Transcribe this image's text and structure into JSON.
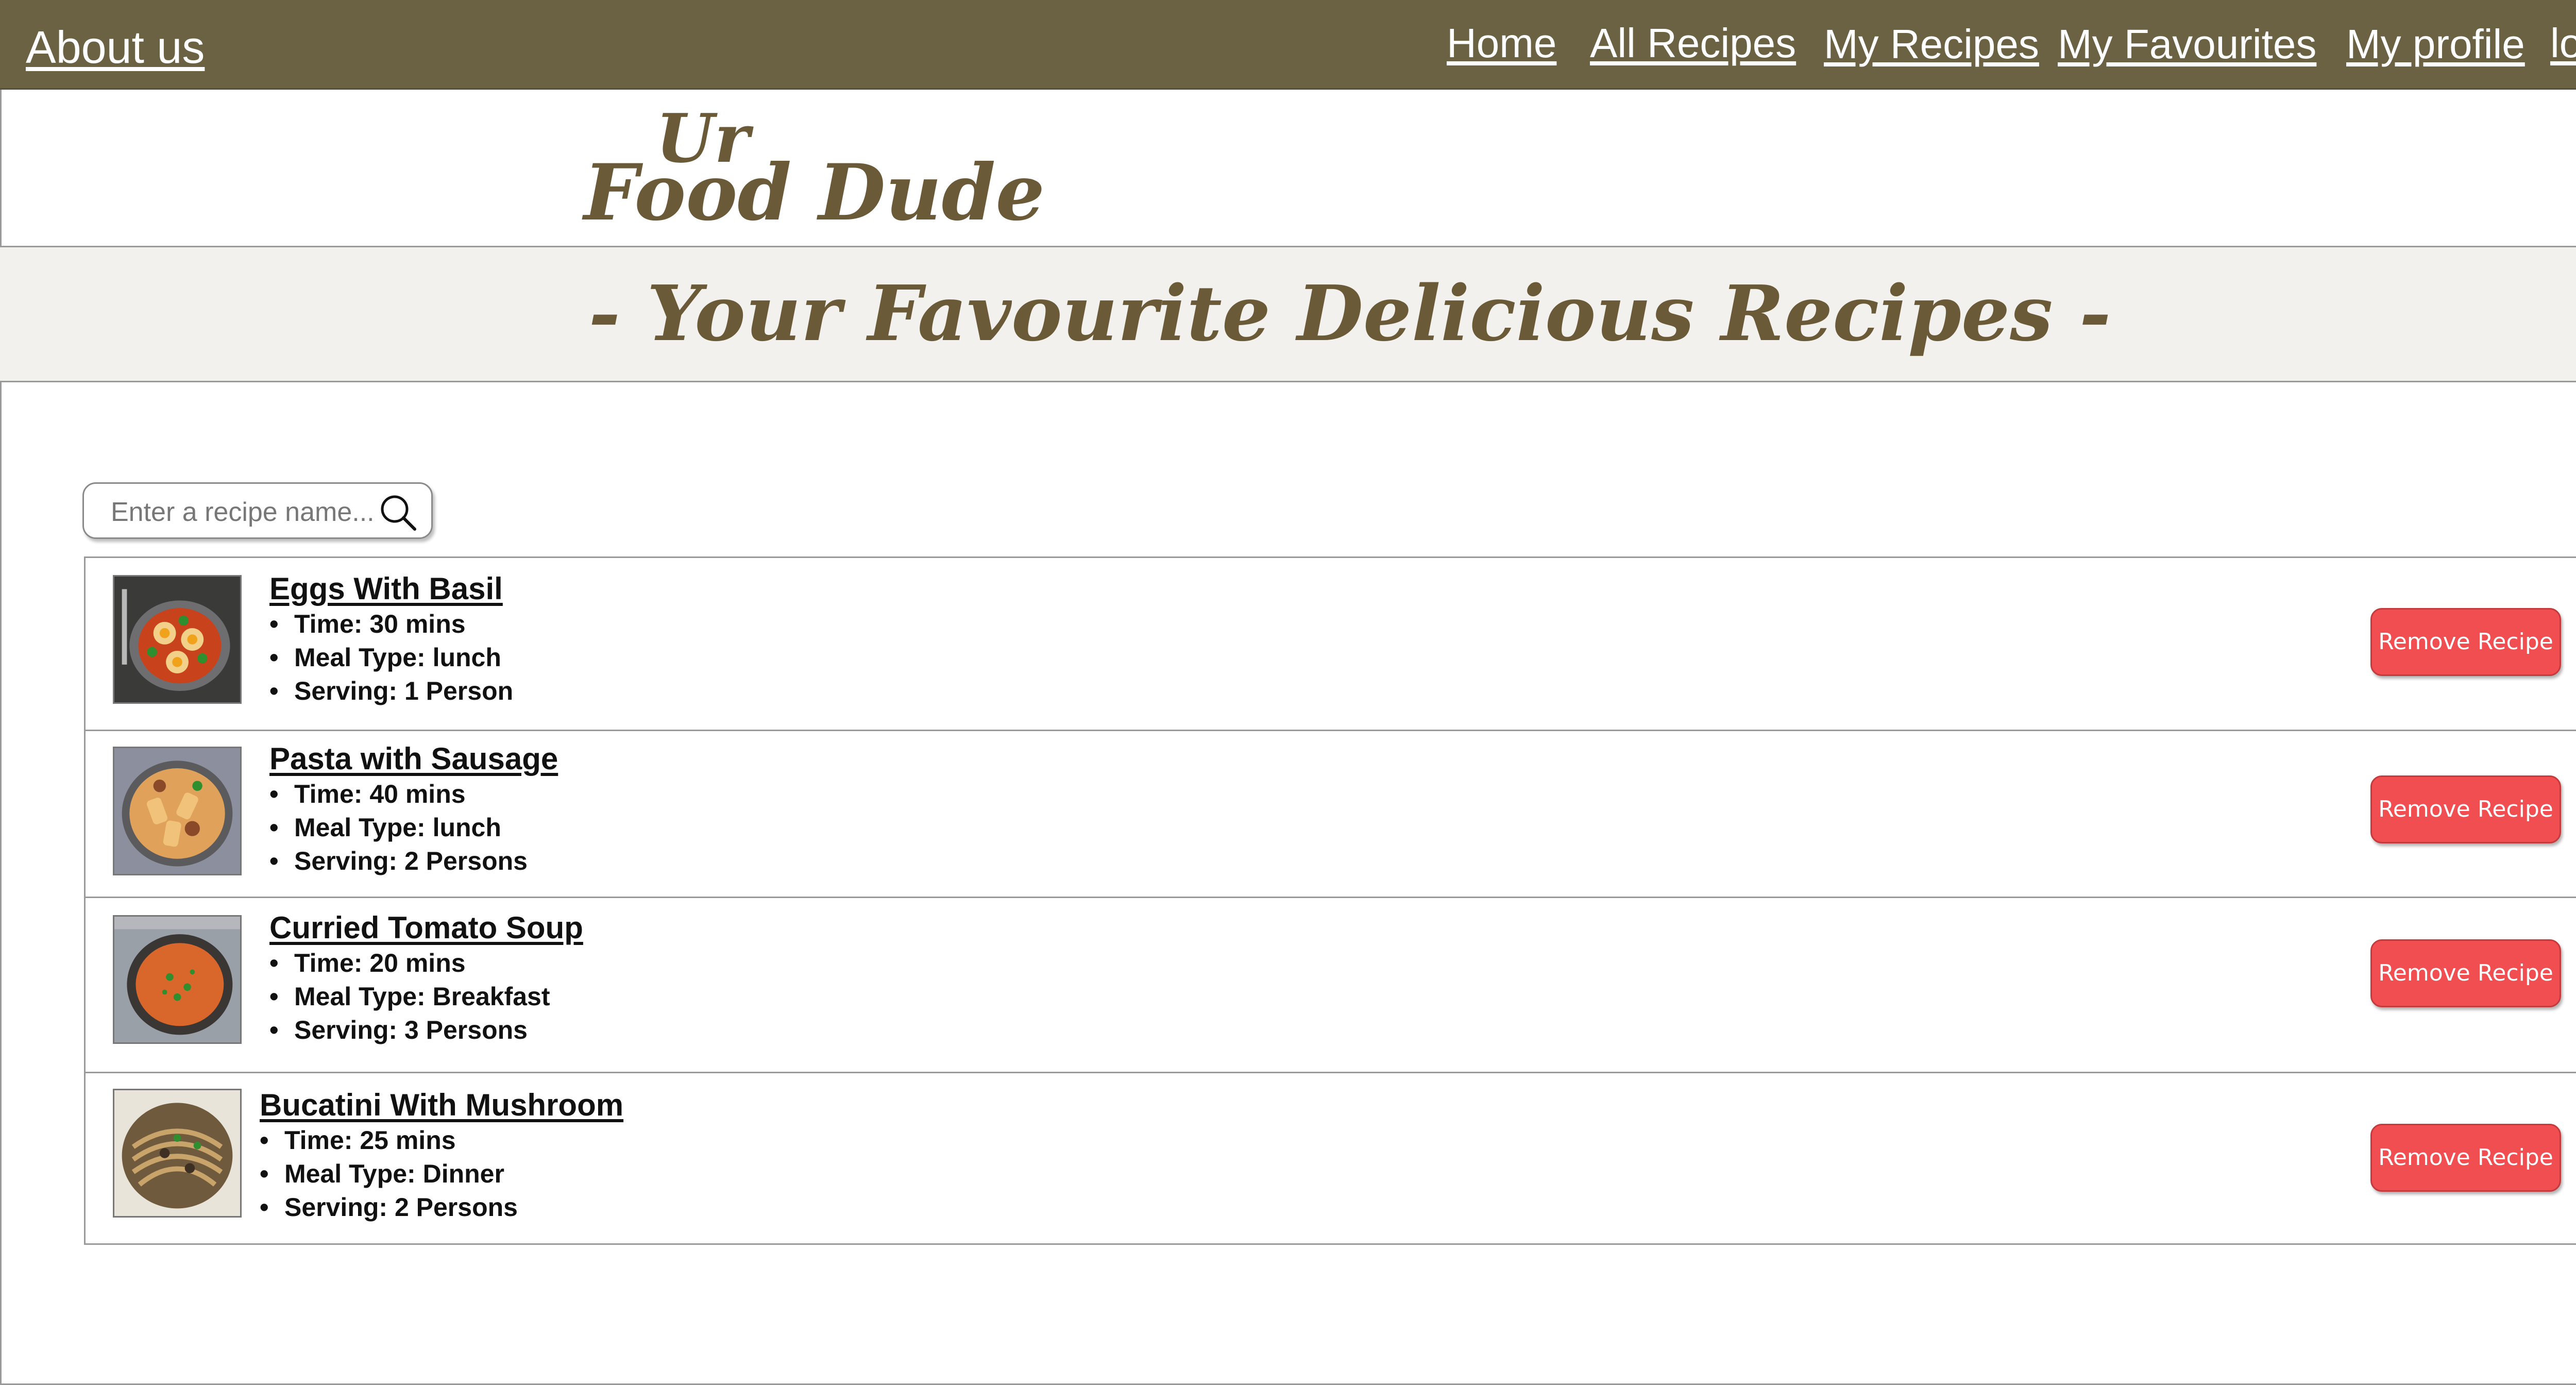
{
  "nav": {
    "about": "About us",
    "links": [
      "Home",
      "All Recipes",
      "My Recipes",
      "My Favourites",
      "My profile",
      "log out"
    ]
  },
  "logo": {
    "line1": "Ur",
    "line2": "Food Dude"
  },
  "heading": "- Your Favourite Delicious Recipes -",
  "search": {
    "placeholder": "Enter a recipe name...",
    "value": "",
    "icon": "search-icon"
  },
  "recipes": [
    {
      "title": "Eggs With Basil",
      "time": "Time: 30  mins",
      "meal": "Meal Type: lunch",
      "serving": "Serving: 1 Person",
      "button": "Remove Recipe"
    },
    {
      "title": "Pasta with Sausage",
      "time": "Time: 40  mins",
      "meal": "Meal Type: lunch",
      "serving": "Serving: 2 Persons",
      "button": "Remove Recipe"
    },
    {
      "title": "Curried Tomato Soup",
      "time": "Time: 20  mins",
      "meal": "Meal Type: Breakfast",
      "serving": "Serving: 3 Persons",
      "button": "Remove Recipe"
    },
    {
      "title": "Bucatini With Mushroom",
      "time": "Time: 25  mins",
      "meal": "Meal Type: Dinner",
      "serving": "Serving: 2 Persons",
      "button": "Remove Recipe"
    }
  ],
  "colors": {
    "nav_bg": "#6b6244",
    "brand_text": "#6b5a38",
    "heading_bg": "#f2f1ed",
    "remove_button": "#f04e51"
  }
}
